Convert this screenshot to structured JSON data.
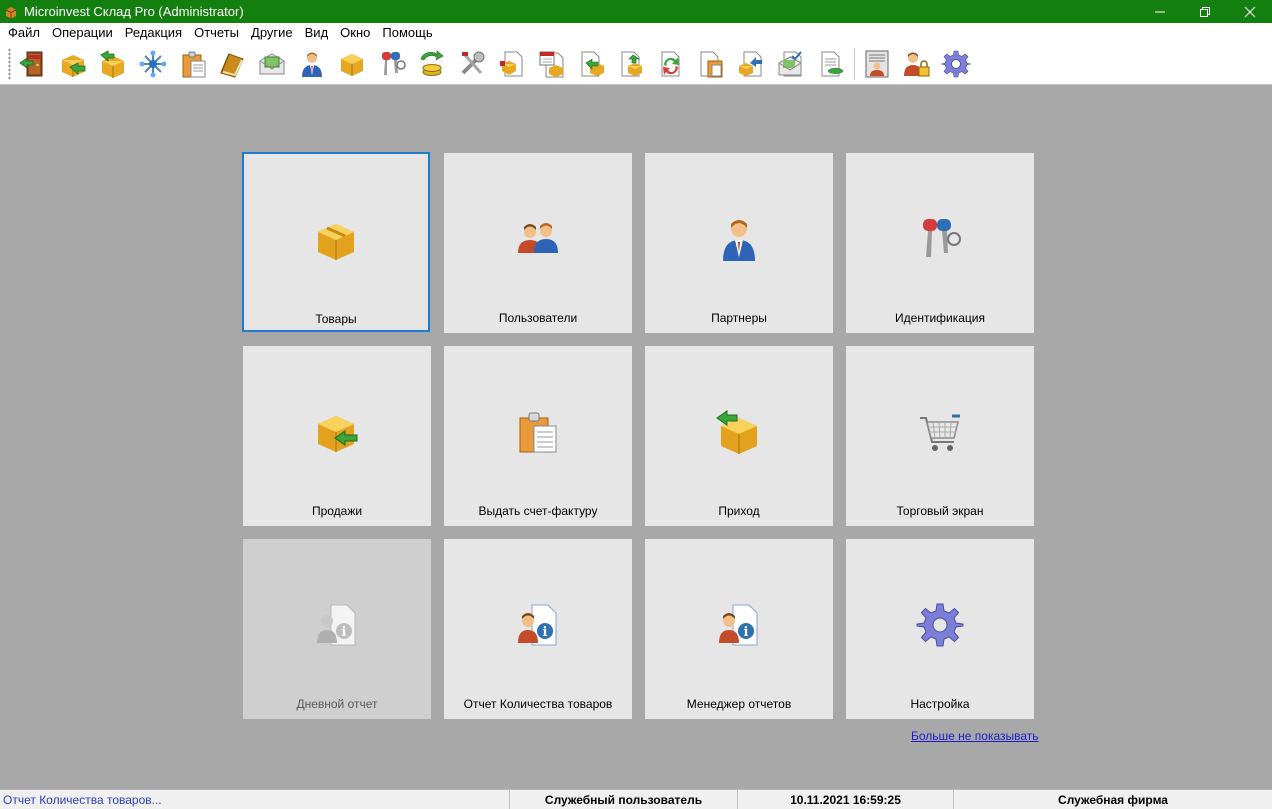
{
  "window": {
    "title": "Microinvest Склад Pro (Administrator)",
    "controls": [
      "minimize-icon",
      "restore-icon",
      "close-icon"
    ]
  },
  "menu": [
    "Файл",
    "Операции",
    "Редакция",
    "Отчеты",
    "Другие",
    "Вид",
    "Окно",
    "Помощь"
  ],
  "toolbar": {
    "buttons": [
      "exit-icon",
      "box-sales-icon",
      "box-arrow-icon",
      "network-icon",
      "clipboard-icon",
      "book-icon",
      "envelope-money-icon",
      "partner-icon",
      "box-icon",
      "keys-icon",
      "coins-arrows-icon",
      "tools-icon",
      "doc-box-icon",
      "calendar-doc-icon",
      "doc-arrow-icon",
      "doc-box-arrow-icon",
      "doc-refresh-icon",
      "doc-clipboard-icon",
      "doc-box-up-icon",
      "doc-envelope-check-icon",
      "doc-list-icon",
      "report-person-icon",
      "user-lock-icon",
      "gear-icon"
    ]
  },
  "tiles": [
    {
      "label": "Товары",
      "icon": "box-icon",
      "selected": true,
      "enabled": true
    },
    {
      "label": "Пользователи",
      "icon": "users-icon",
      "selected": false,
      "enabled": true
    },
    {
      "label": "Партнеры",
      "icon": "partner-icon",
      "selected": false,
      "enabled": true
    },
    {
      "label": "Идентификация",
      "icon": "keys-icon",
      "selected": false,
      "enabled": true
    },
    {
      "label": "Продажи",
      "icon": "box-arrow-out-icon",
      "selected": false,
      "enabled": true
    },
    {
      "label": "Выдать счет-фактуру",
      "icon": "invoice-clipboard-icon",
      "selected": false,
      "enabled": true
    },
    {
      "label": "Приход",
      "icon": "box-arrow-in-icon",
      "selected": false,
      "enabled": true
    },
    {
      "label": "Торговый экран",
      "icon": "shopping-cart-icon",
      "selected": false,
      "enabled": true
    },
    {
      "label": "Дневной отчет",
      "icon": "report-info-icon",
      "selected": false,
      "enabled": false
    },
    {
      "label": "Отчет Количества товаров",
      "icon": "report-info-icon",
      "selected": false,
      "enabled": true
    },
    {
      "label": "Менеджер отчетов",
      "icon": "report-info-icon",
      "selected": false,
      "enabled": true
    },
    {
      "label": "Настройка",
      "icon": "gear-icon",
      "selected": false,
      "enabled": true
    }
  ],
  "dont_show_link": "Больше не показывать",
  "status": {
    "task": "Отчет Количества товаров...",
    "user": "Служебный пользователь",
    "datetime": "10.11.2021 16:59:25",
    "company": "Служебная фирма"
  },
  "colors": {
    "titlebar": "#127f0f",
    "workspace": "#a8a8a8",
    "tile": "#e6e6e6",
    "tile_disabled": "#cfcfcf",
    "selection": "#1f7ad0",
    "link": "#1e1ec8",
    "status_task": "#2a3fd0"
  }
}
